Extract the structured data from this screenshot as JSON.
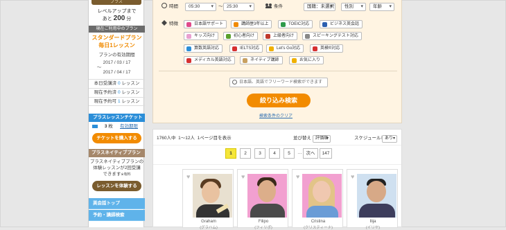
{
  "sidebar": {
    "plus_label": "プラス",
    "level_up_line1": "レベルアップまで",
    "level_up_prefix": "あと",
    "level_up_value": "200",
    "level_up_unit": "分",
    "current_plan_header": "現在ご利用中のプラン",
    "plan_name_line1": "スタンダードプラン",
    "plan_name_line2": "毎日1レッスン",
    "valid_period_label": "プランの有効期間",
    "valid_from": "2017 / 03 / 17",
    "valid_to_prefix": "〜",
    "valid_to": "2017 / 04 / 17",
    "rows": [
      {
        "label": "本日受講済",
        "value": "0",
        "unit": "レッスン"
      },
      {
        "label": "現在予約済",
        "value": "0",
        "unit": "レッスン"
      },
      {
        "label": "現在予約可",
        "value": "1",
        "unit": "レッスン"
      }
    ],
    "ticket_header": "プラスレッスンチケット",
    "ticket_count": "3",
    "ticket_unit": "枚",
    "ticket_expiry_link": "有効期限",
    "ticket_buy_button": "チケットを購入する",
    "native_trial_header": "プラスネイティブプラン体験",
    "native_trial_text1": "プラスネイティブプランの",
    "native_trial_text2": "体験レッスンが2回受講",
    "native_trial_text3": "できます",
    "native_trial_note": "※有料",
    "native_trial_button": "レッスンを体験する",
    "nav_items": [
      "英会話トップ",
      "予約・講師検索"
    ]
  },
  "filter": {
    "time_label": "時間",
    "time_from": "05:30",
    "time_sep": "〜",
    "time_to": "25:30",
    "conditions_label": "条件",
    "nationality": "国籍：未選択",
    "gender": "性別",
    "age": "年齢",
    "features_label": "特徴",
    "tags": [
      {
        "label": "日本語サポート",
        "color": "#e04a8a"
      },
      {
        "label": "講師歴3年以上",
        "color": "#f08a00"
      },
      {
        "label": "TOEIC対応",
        "color": "#2e9a4a"
      },
      {
        "label": "ビジネス英会話",
        "color": "#2b5fb0"
      },
      {
        "label": "キッズ向け",
        "color": "#e8a0d0"
      },
      {
        "label": "初心者向け",
        "color": "#5aa02c"
      },
      {
        "label": "上級者向け",
        "color": "#c0392b"
      },
      {
        "label": "スピーキングテスト対応",
        "color": "#888888"
      },
      {
        "label": "算数英語対応",
        "color": "#2b8ed8"
      },
      {
        "label": "IELTS対応",
        "color": "#d63030"
      },
      {
        "label": "Let's Go対応",
        "color": "#f0b000"
      },
      {
        "label": "英検®対応",
        "color": "#d63030"
      },
      {
        "label": "メディカル英語対応",
        "color": "#d63030"
      },
      {
        "label": "ネイティブ講師",
        "color": "#c8a060"
      },
      {
        "label": "お気に入り",
        "color": "#f0b000"
      }
    ],
    "search_placeholder": "日本語、英語でフリーワード検索ができます",
    "narrow_button": "絞り込み検索",
    "clear_link": "検索条件のクリア"
  },
  "results": {
    "total": "1760人中",
    "range": "1〜12人",
    "per_page": "1ページ目を表示",
    "sort_label": "並び替え",
    "sort_value": "評価順",
    "schedule_label": "スケジュール表示",
    "schedule_value": "あり",
    "pages": [
      "1",
      "2",
      "3",
      "4",
      "5"
    ],
    "ellipsis": "…",
    "next": "次へ",
    "last": "147",
    "tutors": [
      {
        "name": "Graham",
        "sub": "(グラハム)",
        "bg": "#e8e0d0",
        "skin": "#e9c2a0",
        "hair": "#5a3c22",
        "shirt": "#333333"
      },
      {
        "name": "Filipo",
        "sub": "(フィリポ)",
        "bg": "#f2a0d0",
        "skin": "#dcae8a",
        "hair": "#3a2a1a",
        "shirt": "#4a4a4a"
      },
      {
        "name": "Cristina",
        "sub": "(クリスティーナ)",
        "bg": "#f2a0d0",
        "skin": "#f0c8b0",
        "hair": "#e2c488",
        "shirt": "#6a9cd6"
      },
      {
        "name": "Ilija",
        "sub": "(イリヤ)",
        "bg": "#cfe0f0",
        "skin": "#d7a987",
        "hair": "#222222",
        "shirt": "#3d3d5c"
      }
    ]
  }
}
